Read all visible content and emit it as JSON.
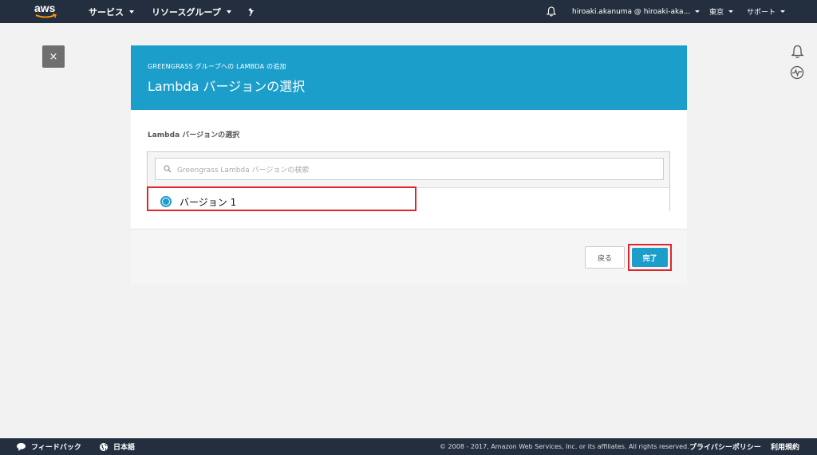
{
  "topnav": {
    "logo_text": "aws",
    "services_label": "サービス",
    "resource_groups_label": "リソースグループ",
    "pin_icon": "pin-icon",
    "bell_icon": "bell-icon",
    "account_label": "hiroaki.akanuma @ hiroaki-aka...",
    "region_label": "東京",
    "support_label": "サポート"
  },
  "wizard": {
    "close_symbol": "×",
    "header_subtitle": "GREENGRASS グループへの LAMBDA の追加",
    "header_title": "Lambda バージョンの選択",
    "section_label": "Lambda バージョンの選択",
    "search": {
      "placeholder": "Greengrass Lambda バージョンの検索",
      "value": ""
    },
    "versions": [
      {
        "label": "バージョン 1",
        "selected": true
      }
    ],
    "back_button": "戻る",
    "done_button": "完了"
  },
  "side_icons": [
    "notification-bell-icon",
    "health-pulse-icon"
  ],
  "footer": {
    "feedback": "フィードバック",
    "language": "日本語",
    "copyright": "© 2008 - 2017, Amazon Web Services, Inc. or its affiliates. All rights reserved.",
    "privacy": "プライバシーポリシー",
    "terms": "利用規約"
  },
  "colors": {
    "nav_bg": "#232f3e",
    "accent": "#1c9ecb",
    "highlight": "#e0262c",
    "page_bg": "#f2f2f2"
  }
}
